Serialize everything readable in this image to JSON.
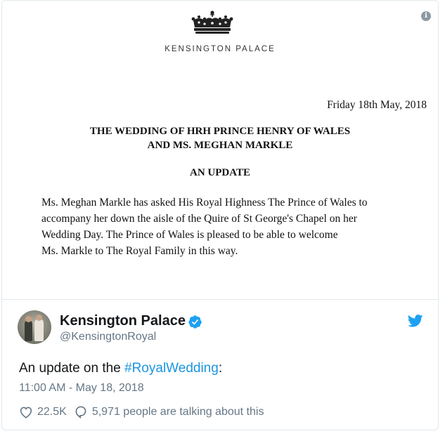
{
  "embed": {
    "org": "KENSINGTON PALACE",
    "date": "Friday 18th May, 2018",
    "heading_line1": "THE WEDDING OF HRH PRINCE HENRY OF WALES",
    "heading_line2": "AND MS. MEGHAN MARKLE",
    "subheading": "AN UPDATE",
    "body_lines": [
      "Ms. Meghan Markle has asked His Royal Highness The Prince of Wales to",
      "accompany her down the aisle of the Quire of St George's Chapel on her",
      "Wedding Day. The Prince of Wales is pleased to be able to welcome",
      "Ms. Markle to The Royal Family in this way."
    ]
  },
  "tweet": {
    "name": "Kensington Palace",
    "handle": "@KensingtonRoyal",
    "text_prefix": "An update on the ",
    "hashtag": "#RoyalWedding",
    "text_suffix": ":",
    "timestamp": "11:00 AM - May 18, 2018",
    "likes": "22.5K",
    "talking": "5,971 people are talking about this"
  },
  "colors": {
    "link": "#1b95e0",
    "muted": "#657786",
    "verified": "#1da1f2",
    "border": "#e1e8ed"
  },
  "icons": {
    "info": "info-icon",
    "crown": "crown-icon",
    "verified": "verified-badge-icon",
    "bird": "twitter-bird-icon",
    "heart": "heart-icon",
    "reply": "speech-bubble-icon"
  }
}
